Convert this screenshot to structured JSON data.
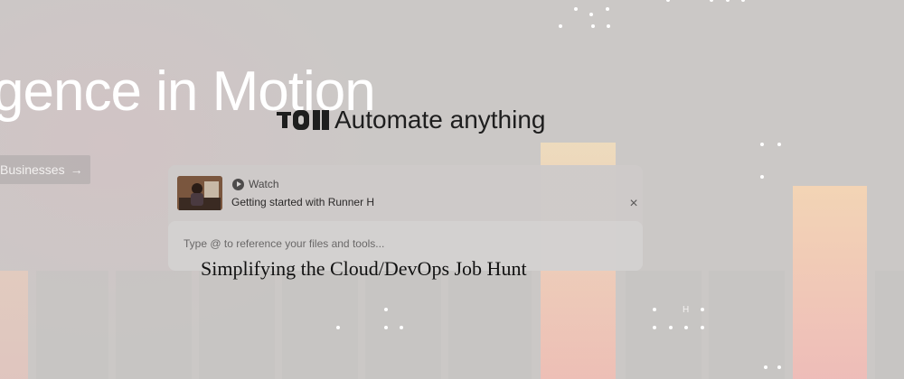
{
  "hero": {
    "title": "gence in Motion",
    "businesses_button": "Businesses",
    "businesses_arrow": "→"
  },
  "brand": {
    "logo": "brand-logo-icon",
    "tagline": "Automate anything"
  },
  "card": {
    "watch_label": "Watch",
    "video_title": "Getting started with Runner H",
    "close_symbol": "×",
    "prompt_placeholder": "Type @ to reference your files and tools..."
  },
  "overlay": {
    "headline": "Simplifying the Cloud/DevOps Job Hunt",
    "h_mark": "H"
  },
  "colors": {
    "background": "#cbc8c6",
    "bar_top": "#f1ddbc",
    "bar_bottom": "#f1beb4",
    "text_dark": "#1e1e1e"
  }
}
